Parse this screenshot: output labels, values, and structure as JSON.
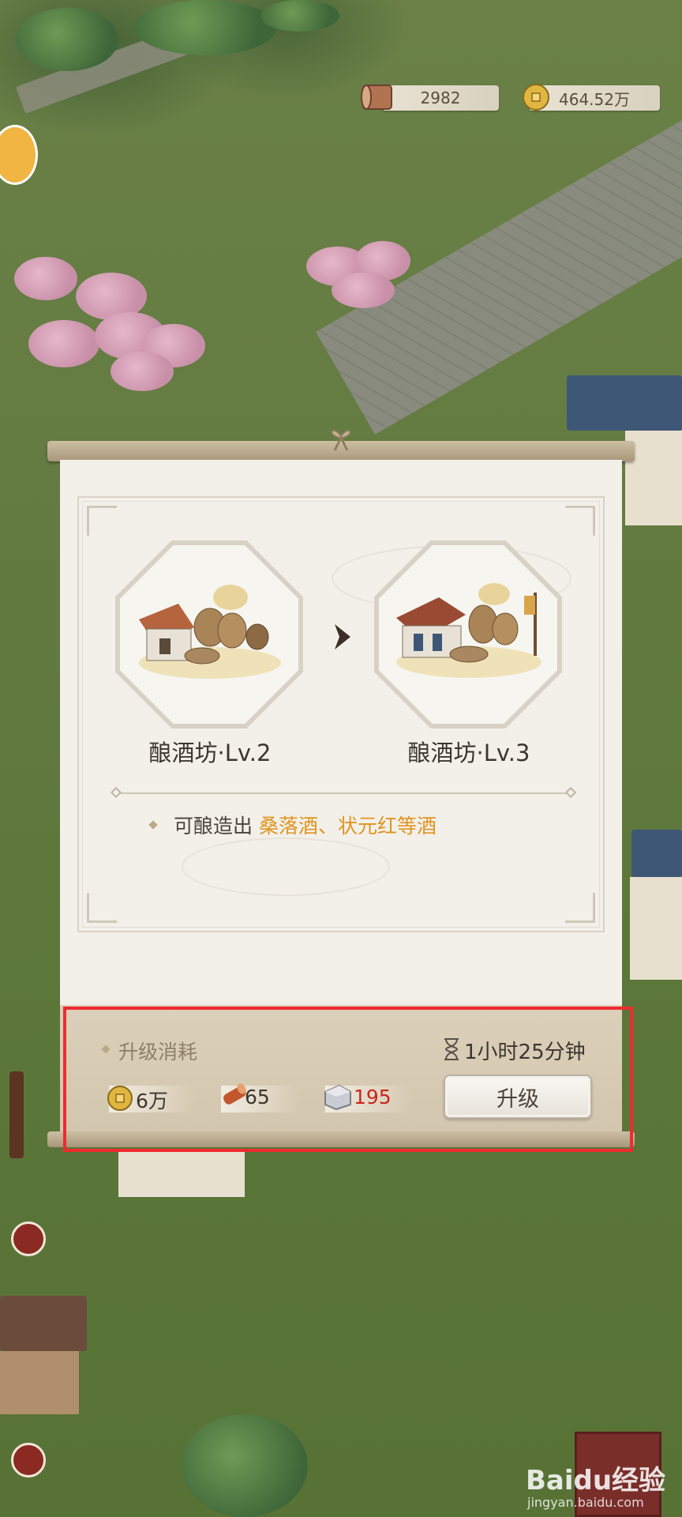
{
  "resources": {
    "wood": "2982",
    "coins": "464.52万"
  },
  "upgrade": {
    "from_label": "酿酒坊·Lv.2",
    "to_label": "酿酒坊·Lv.3",
    "description_prefix": "可酿造出",
    "description_highlight": "桑落酒、状元红等酒",
    "cost_title": "升级消耗",
    "time": "1小时25分钟",
    "costs": [
      {
        "icon": "coin-icon",
        "value": "6万"
      },
      {
        "icon": "wood-log-icon",
        "value": "65"
      },
      {
        "icon": "stone-icon",
        "value": "195",
        "insufficient": true
      }
    ],
    "button_label": "升级"
  },
  "watermark": {
    "brand": "Baidu经验",
    "url": "jingyan.baidu.com"
  },
  "colors": {
    "highlight": "#e0941f",
    "insufficient": "#c9261e",
    "annotation_box": "#ef2b30"
  }
}
